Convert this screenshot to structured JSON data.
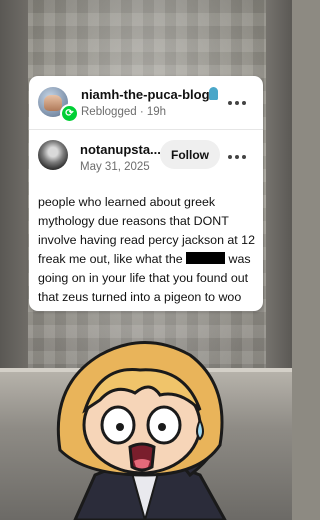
{
  "reblog": {
    "blog_name": "niamh-the-puca-blog",
    "meta": "Reblogged · 19h"
  },
  "original_post": {
    "blog_name": "notanupsta...",
    "date": "May 31, 2025",
    "follow_label": "Follow",
    "text_before_redaction": "people who learned about greek mythology due reasons that DONT involve having read percy jackson at 12 freak me out, like what the ",
    "text_after_redaction": " was going on in your life that you found out that zeus turned into a pigeon to woo his wife like HOW"
  },
  "icons": {
    "more": "more-horizontal-icon",
    "reblog_badge": "reblog-icon",
    "blog_badge": "ghost-icon"
  },
  "colors": {
    "reblog_green": "#00cf35",
    "badge_blue": "#4aa7c9"
  }
}
